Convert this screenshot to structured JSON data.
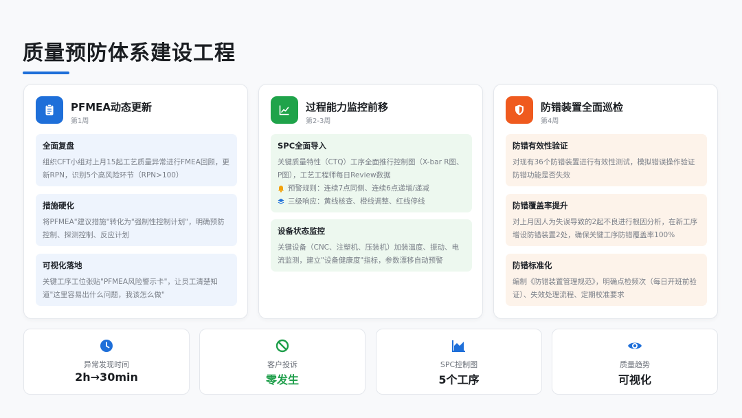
{
  "page": {
    "title": "质量预防体系建设工程"
  },
  "cards": [
    {
      "title": "PFMEA动态更新",
      "subtitle": "第1周",
      "icon": "clipboard-icon",
      "accent": "#1e6fd9",
      "blocks": [
        {
          "heading": "全面复盘",
          "text": "组织CFT小组对上月15起工艺质量异常进行FMEA回顾，更新RPN，识别5个高风险环节（RPN>100）"
        },
        {
          "heading": "措施硬化",
          "text": "将PFMEA\"建议措施\"转化为\"强制性控制计划\"，明确预防控制、探测控制、反应计划"
        },
        {
          "heading": "可视化落地",
          "text": "关键工序工位张贴\"PFMEA风险警示卡\"，让员工清楚知道\"这里容易出什么问题，我该怎么做\""
        }
      ]
    },
    {
      "title": "过程能力监控前移",
      "subtitle": "第2-3周",
      "icon": "line-chart-icon",
      "accent": "#1fa34a",
      "blocks": [
        {
          "heading": "SPC全面导入",
          "text": "关键质量特性（CTQ）工序全面推行控制图（X-bar R图、P图），工艺工程师每日Review数据",
          "bullets": [
            {
              "icon": "bell-icon",
              "text": "预警规则：连续7点同侧、连续6点递增/递减"
            },
            {
              "icon": "layers-icon",
              "text": "三级响应：黄线核查、橙线调整、红线停线"
            }
          ]
        },
        {
          "heading": "设备状态监控",
          "text": "关键设备（CNC、注塑机、压装机）加装温度、振动、电流监测，建立\"设备健康度\"指标，参数漂移自动预警"
        }
      ]
    },
    {
      "title": "防错装置全面巡检",
      "subtitle": "第4周",
      "icon": "shield-icon",
      "accent": "#ef5a1e",
      "blocks": [
        {
          "heading": "防错有效性验证",
          "text": "对现有36个防错装置进行有效性测试，模拟错误操作验证防错功能是否失效"
        },
        {
          "heading": "防错覆盖率提升",
          "text": "对上月因人为失误导致的2起不良进行根因分析，在新工序增设防错装置2处，确保关键工序防错覆盖率100%"
        },
        {
          "heading": "防错标准化",
          "text": "编制《防错装置管理规范》，明确点检频次（每日开班前验证）、失效处理流程、定期校准要求"
        }
      ]
    }
  ],
  "stats": [
    {
      "icon": "clock-icon",
      "label": "异常发现时间",
      "value": "2h→30min",
      "color": "#1e6fd9"
    },
    {
      "icon": "no-entry-icon",
      "label": "客户投诉",
      "value": "零发生",
      "color": "#1e9e4a"
    },
    {
      "icon": "area-chart-icon",
      "label": "SPC控制图",
      "value": "5个工序",
      "color": "#1e6fd9"
    },
    {
      "icon": "eye-icon",
      "label": "质量趋势",
      "value": "可视化",
      "color": "#1e6fd9"
    }
  ]
}
